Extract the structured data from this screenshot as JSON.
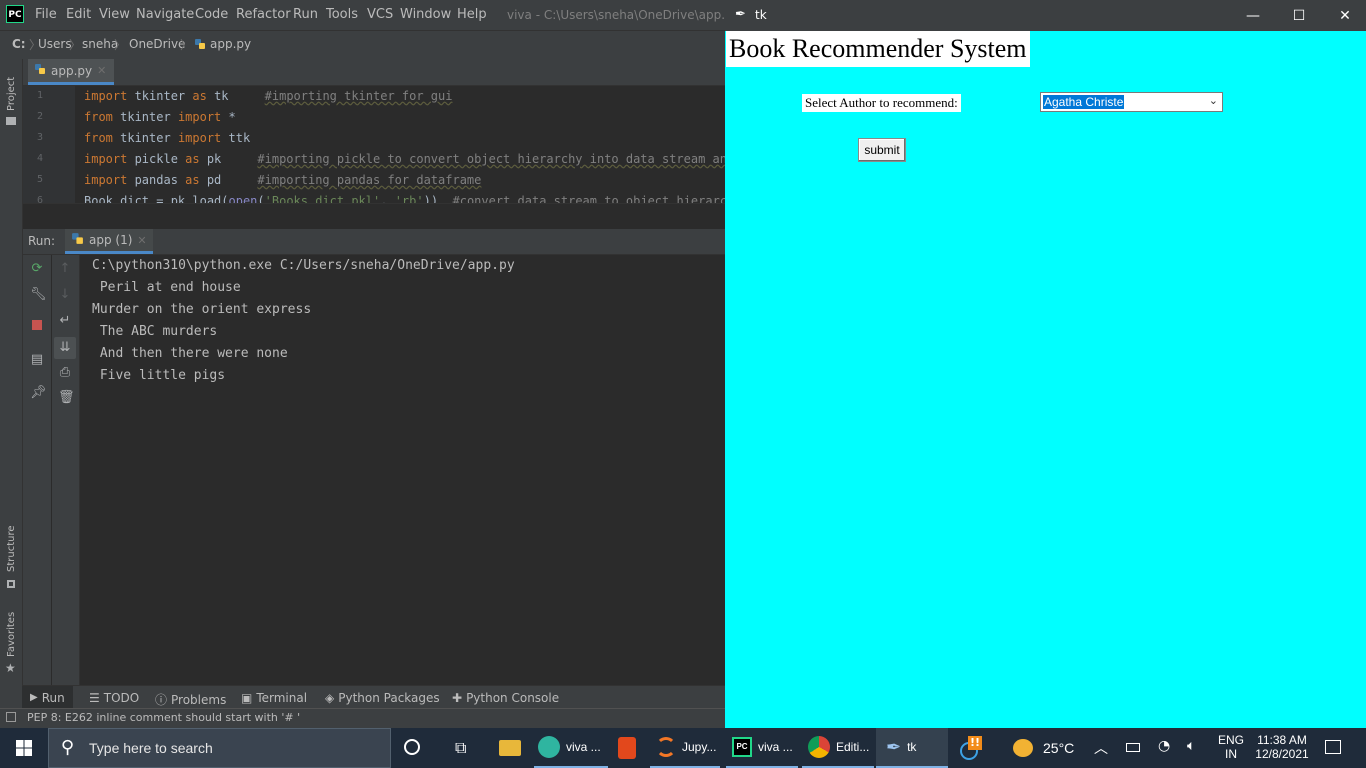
{
  "ide": {
    "menu": [
      "File",
      "Edit",
      "View",
      "Navigate",
      "Code",
      "Refactor",
      "Run",
      "Tools",
      "VCS",
      "Window",
      "Help"
    ],
    "window_title": "viva - C:\\Users\\sneha\\OneDrive\\app.py",
    "breadcrumbs": [
      "C:",
      "Users",
      "sneha",
      "OneDrive",
      "app.py"
    ],
    "side_tabs": {
      "project": "Project",
      "structure": "Structure",
      "favorites": "Favorites"
    },
    "file_tab": "app.py",
    "line_numbers": [
      "1",
      "2",
      "3",
      "4",
      "5",
      "6"
    ],
    "run_label": "Run:",
    "run_tab": "app (1)",
    "console_lines": [
      "C:\\python310\\python.exe C:/Users/sneha/OneDrive/app.py",
      " Peril at end house",
      "Murder on the orient express",
      " The ABC murders",
      " And then there were none",
      " Five little pigs"
    ],
    "bottom_tools": [
      "Run",
      "TODO",
      "Problems",
      "Terminal",
      "Python Packages",
      "Python Console"
    ],
    "status": "PEP 8: E262 inline comment should start with '# '"
  },
  "tk": {
    "title": "tk",
    "heading": "Book Recommender System",
    "author_label": "Select Author to recommend:",
    "author_selected": "Agatha Christe",
    "submit_label": "submit",
    "background": "#00ffff"
  },
  "taskbar": {
    "search_placeholder": "Type here to search",
    "apps": [
      {
        "label": "viva ...",
        "icon": "edge-icon"
      },
      {
        "label": "",
        "icon": "office-icon"
      },
      {
        "label": "Jupy...",
        "icon": "jupyter-icon"
      },
      {
        "label": "viva ...",
        "icon": "pycharm-icon"
      },
      {
        "label": "Editi...",
        "icon": "chrome-icon"
      },
      {
        "label": "tk",
        "icon": "feather-icon"
      }
    ],
    "temperature": "25°C",
    "lang_top": "ENG",
    "lang_bottom": "IN",
    "time": "11:38 AM",
    "date": "12/8/2021"
  }
}
